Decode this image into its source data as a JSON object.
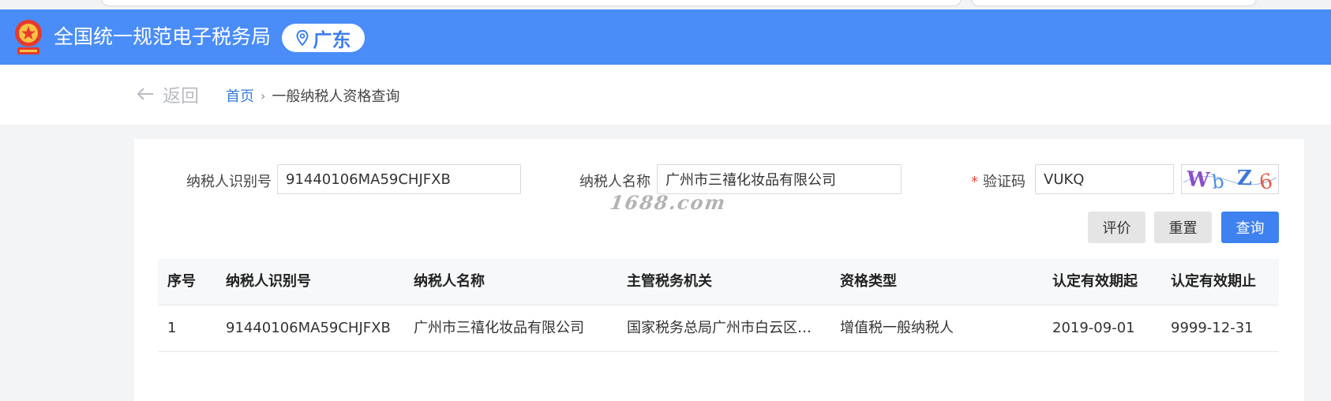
{
  "header": {
    "site_title": "全国统一规范电子税务局",
    "region": "广东",
    "brand_color": "#4a8df8"
  },
  "nav": {
    "back_label": "返回",
    "breadcrumb_home": "首页",
    "breadcrumb_separator": "›",
    "breadcrumb_current": "一般纳税人资格查询"
  },
  "form": {
    "taxpayer_id_label": "纳税人识别号",
    "taxpayer_id_value": "91440106MA59CHJFXB",
    "taxpayer_name_label": "纳税人名称",
    "taxpayer_name_value": "广州市三禧化妆品有限公司",
    "required_mark": "*",
    "captcha_label": "验证码",
    "captcha_value": "VUKQ",
    "captcha_image_text": "Wb Z6"
  },
  "buttons": {
    "evaluate": "评价",
    "reset": "重置",
    "query": "查询",
    "query_color": "#3e82f2"
  },
  "table": {
    "headers": [
      "序号",
      "纳税人识别号",
      "纳税人名称",
      "主管税务机关",
      "资格类型",
      "认定有效期起",
      "认定有效期止"
    ],
    "rows": [
      [
        "1",
        "91440106MA59CHJFXB",
        "广州市三禧化妆品有限公司",
        "国家税务总局广州市白云区税...",
        "增值税一般纳税人",
        "2019-09-01",
        "9999-12-31"
      ]
    ]
  },
  "watermark": "1688.com"
}
